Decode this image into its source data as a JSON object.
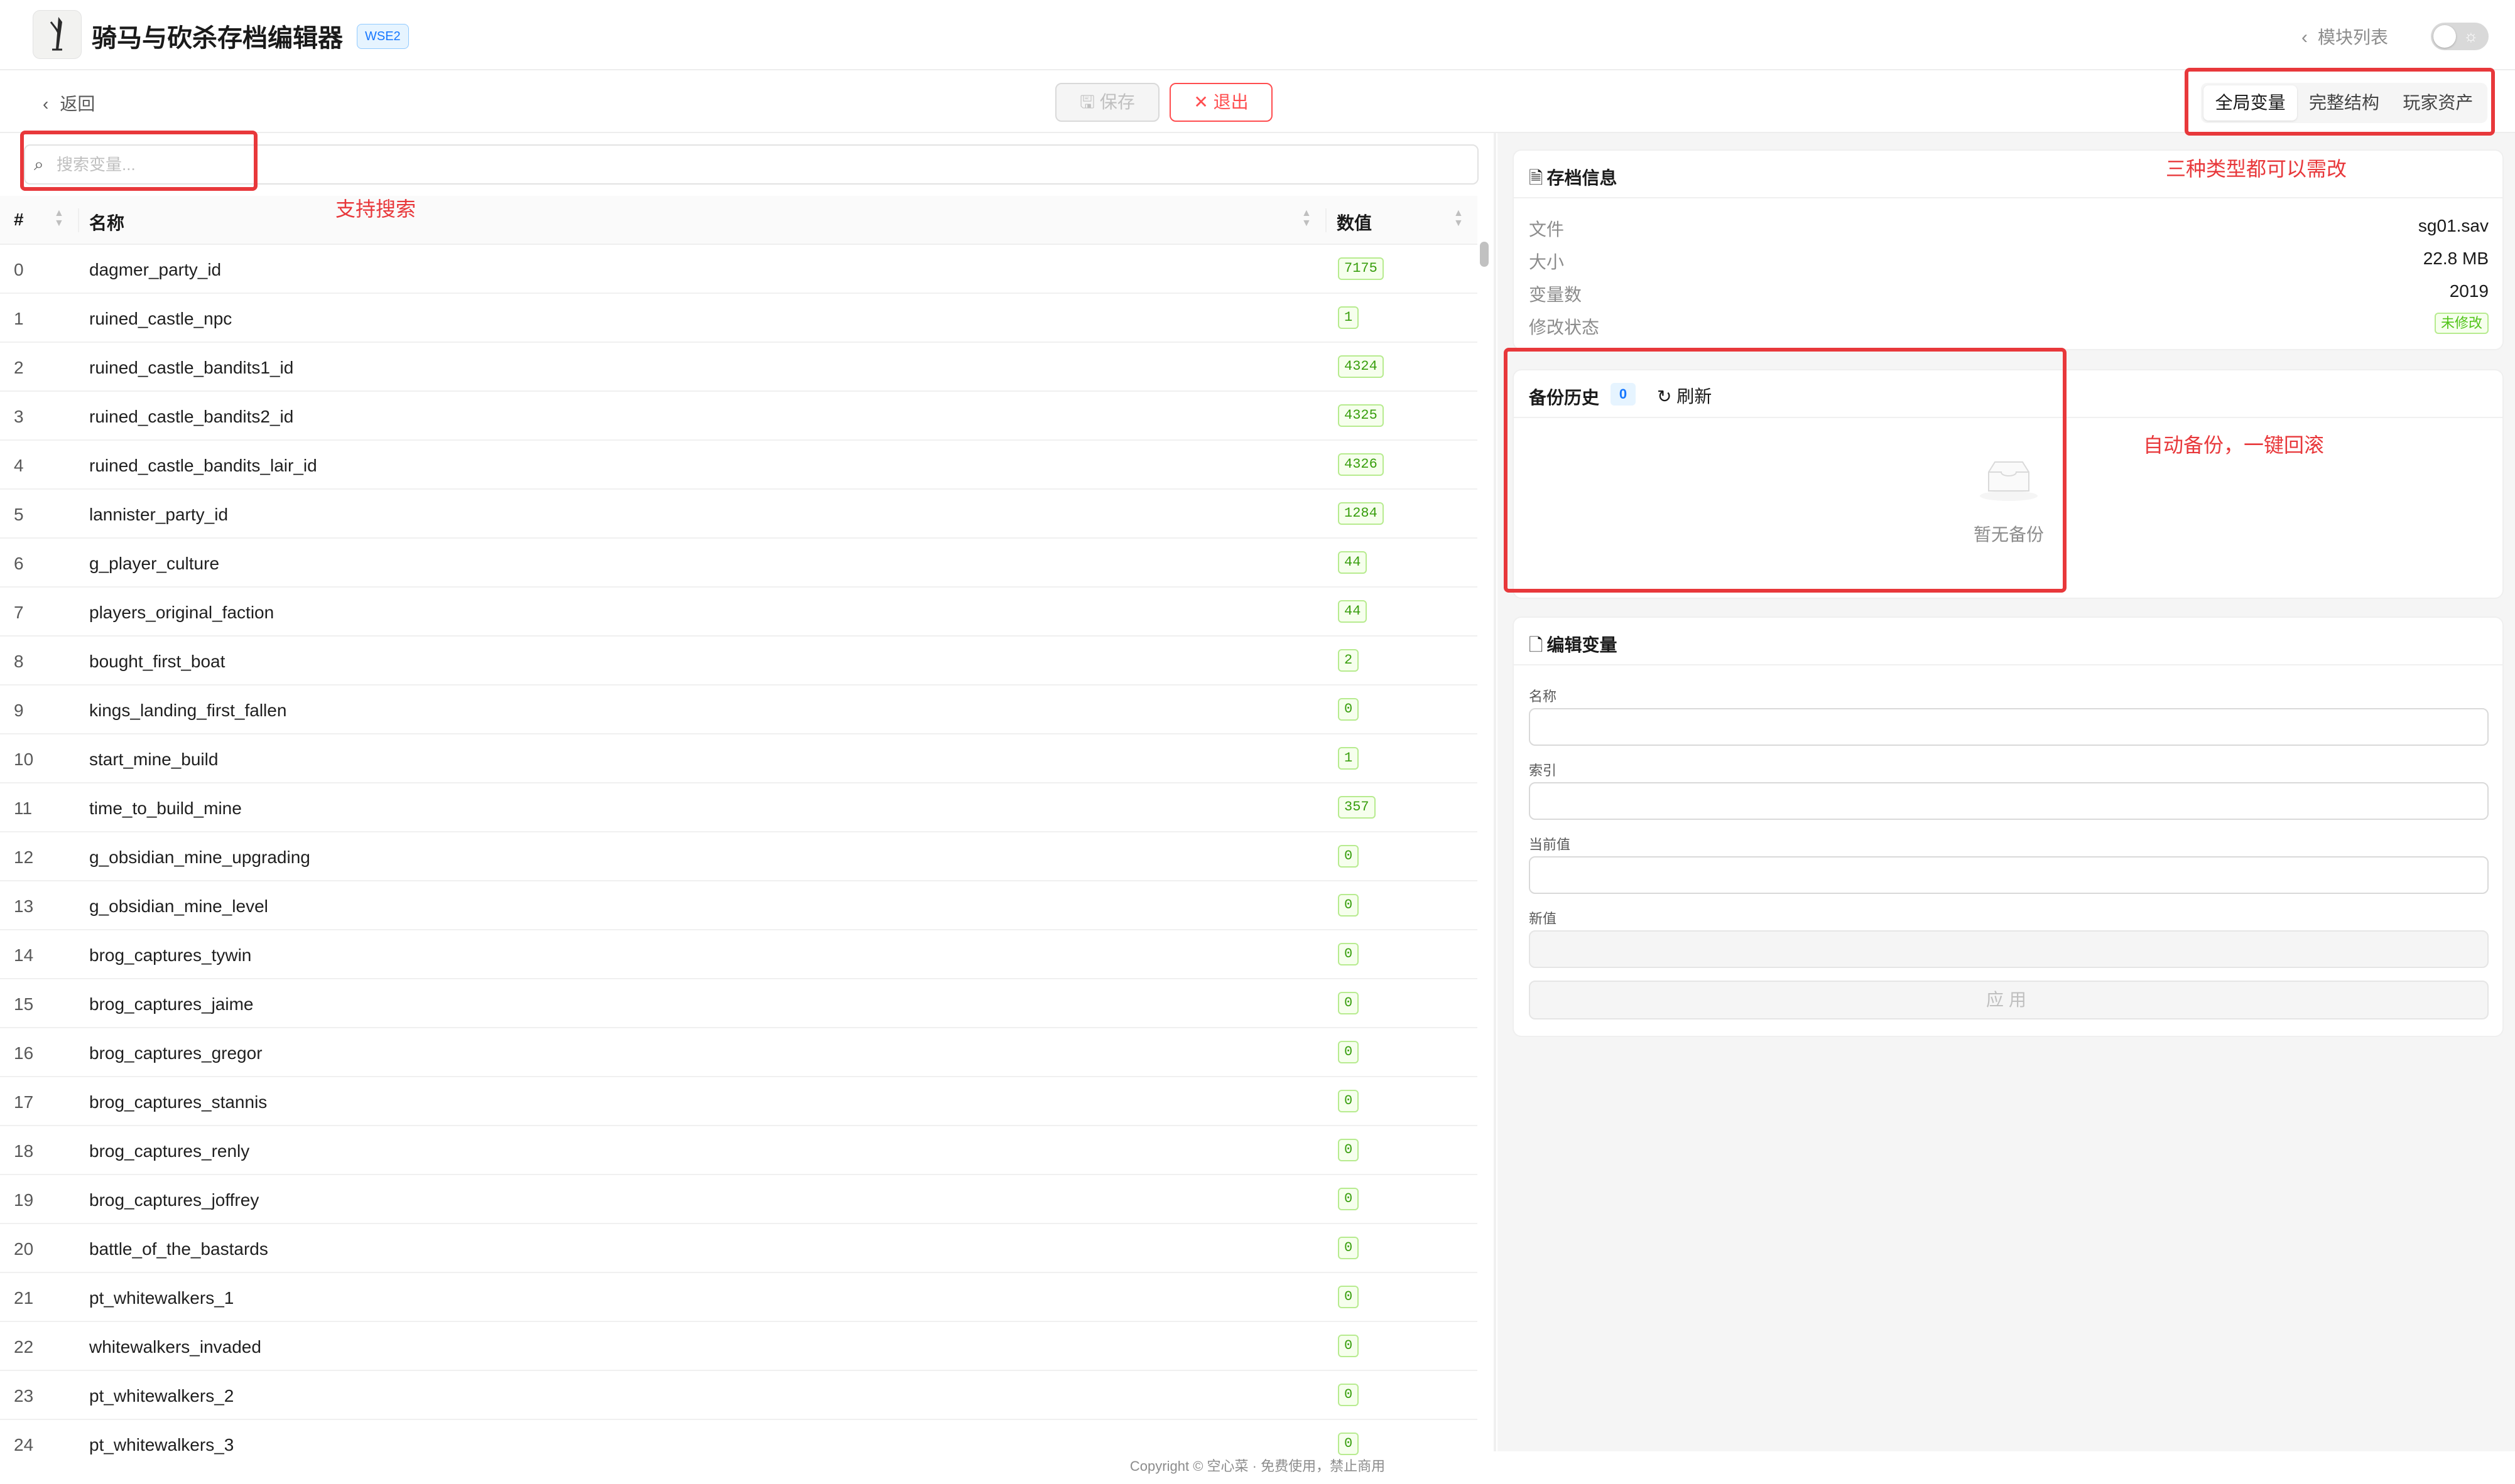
{
  "header": {
    "title": "骑马与砍杀存档编辑器",
    "badge": "WSE2",
    "module_link": "模块列表"
  },
  "toolbar": {
    "back_label": "返回",
    "save_label": "保存",
    "exit_label": "退出",
    "tabs": [
      "全局变量",
      "完整结构",
      "玩家资产"
    ],
    "active_tab": "全局变量"
  },
  "search": {
    "placeholder": "搜索变量..."
  },
  "table": {
    "headers": {
      "index": "#",
      "name": "名称",
      "value": "数值"
    },
    "rows": [
      {
        "i": "0",
        "name": "dagmer_party_id",
        "value": "7175"
      },
      {
        "i": "1",
        "name": "ruined_castle_npc",
        "value": "1"
      },
      {
        "i": "2",
        "name": "ruined_castle_bandits1_id",
        "value": "4324"
      },
      {
        "i": "3",
        "name": "ruined_castle_bandits2_id",
        "value": "4325"
      },
      {
        "i": "4",
        "name": "ruined_castle_bandits_lair_id",
        "value": "4326"
      },
      {
        "i": "5",
        "name": "lannister_party_id",
        "value": "1284"
      },
      {
        "i": "6",
        "name": "g_player_culture",
        "value": "44"
      },
      {
        "i": "7",
        "name": "players_original_faction",
        "value": "44"
      },
      {
        "i": "8",
        "name": "bought_first_boat",
        "value": "2"
      },
      {
        "i": "9",
        "name": "kings_landing_first_fallen",
        "value": "0"
      },
      {
        "i": "10",
        "name": "start_mine_build",
        "value": "1"
      },
      {
        "i": "11",
        "name": "time_to_build_mine",
        "value": "357"
      },
      {
        "i": "12",
        "name": "g_obsidian_mine_upgrading",
        "value": "0"
      },
      {
        "i": "13",
        "name": "g_obsidian_mine_level",
        "value": "0"
      },
      {
        "i": "14",
        "name": "brog_captures_tywin",
        "value": "0"
      },
      {
        "i": "15",
        "name": "brog_captures_jaime",
        "value": "0"
      },
      {
        "i": "16",
        "name": "brog_captures_gregor",
        "value": "0"
      },
      {
        "i": "17",
        "name": "brog_captures_stannis",
        "value": "0"
      },
      {
        "i": "18",
        "name": "brog_captures_renly",
        "value": "0"
      },
      {
        "i": "19",
        "name": "brog_captures_joffrey",
        "value": "0"
      },
      {
        "i": "20",
        "name": "battle_of_the_bastards",
        "value": "0"
      },
      {
        "i": "21",
        "name": "pt_whitewalkers_1",
        "value": "0"
      },
      {
        "i": "22",
        "name": "whitewalkers_invaded",
        "value": "0"
      },
      {
        "i": "23",
        "name": "pt_whitewalkers_2",
        "value": "0"
      },
      {
        "i": "24",
        "name": "pt_whitewalkers_3",
        "value": "0"
      }
    ]
  },
  "save_info": {
    "title": "存档信息",
    "file_label": "文件",
    "file_value": "sg01.sav",
    "size_label": "大小",
    "size_value": "22.8 MB",
    "count_label": "变量数",
    "count_value": "2019",
    "status_label": "修改状态",
    "status_value": "未修改"
  },
  "backup": {
    "title": "备份历史",
    "count": "0",
    "refresh_label": "刷新",
    "empty_text": "暂无备份"
  },
  "edit": {
    "title": "编辑变量",
    "name_label": "名称",
    "index_label": "索引",
    "current_label": "当前值",
    "new_label": "新值",
    "apply_label": "应用"
  },
  "annotations": {
    "search_note": "支持搜索",
    "tabs_note": "三种类型都可以需改",
    "backup_note": "自动备份，一键回滚"
  },
  "footer": {
    "text": "Copyright © 空心菜 · 免费使用，禁止商用"
  },
  "colors": {
    "accent": "#1677ff",
    "danger": "#ff4d4f",
    "success": "#52c41a",
    "annotation": "#e8383b"
  }
}
